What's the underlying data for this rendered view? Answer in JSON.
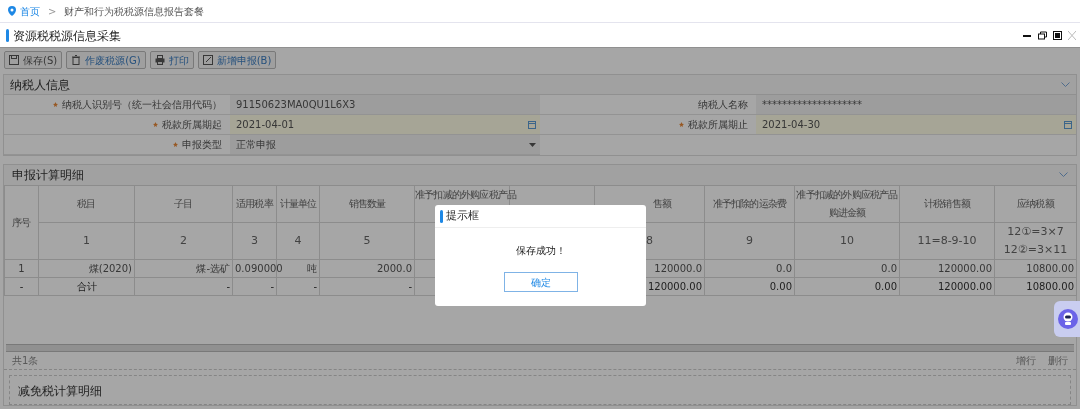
{
  "breadcrumb": {
    "home": "首页",
    "separator": ">",
    "current": "财产和行为税税源信息报告套餐"
  },
  "window": {
    "title": "资源税税源信息采集"
  },
  "toolbar": [
    {
      "label": "保存(S)",
      "kind": "save"
    },
    {
      "label": "作废税源(G)",
      "kind": "delete"
    },
    {
      "label": "打印",
      "kind": "print"
    },
    {
      "label": "新增申报(B)",
      "kind": "edit"
    }
  ],
  "taxpayer": {
    "title": "纳税人信息",
    "fields": [
      {
        "label": "纳税人识别号（统一社会信用代码）",
        "value": "91150623MA0QU1L6X3",
        "required": true,
        "kind": "text"
      },
      {
        "label": "纳税人名称",
        "value": "********************",
        "required": false,
        "kind": "text"
      },
      {
        "label": "税款所属期起",
        "value": "2021-04-01",
        "required": true,
        "kind": "date"
      },
      {
        "label": "税款所属期止",
        "value": "2021-04-30",
        "required": true,
        "kind": "date"
      },
      {
        "label": "申报类型",
        "value": "正常申报",
        "required": true,
        "kind": "select"
      }
    ]
  },
  "detail": {
    "title": "申报计算明细",
    "columns": [
      {
        "header": [
          "序号"
        ]
      },
      {
        "header": [
          "税目"
        ],
        "index": [
          "1"
        ]
      },
      {
        "header": [
          "子目"
        ],
        "index": [
          "2"
        ]
      },
      {
        "header": [
          "适用税率"
        ],
        "index": [
          "3"
        ]
      },
      {
        "header": [
          "计量单位"
        ],
        "index": [
          "4"
        ]
      },
      {
        "header": [
          "销售数量"
        ],
        "index": [
          "5"
        ]
      },
      {
        "header": [
          "准予扣减的外购应税产品"
        ]
      },
      {},
      {
        "header": [
          "售额"
        ],
        "index": [
          "8"
        ]
      },
      {
        "header": [
          "准予扣除的运杂费"
        ],
        "index": [
          "9"
        ]
      },
      {
        "header": [
          "准予扣减的外购应税产品",
          "购进金额"
        ],
        "index": [
          "10"
        ]
      },
      {
        "header": [
          "计税销售额"
        ],
        "index": [
          "11=8-9-10"
        ]
      },
      {
        "header": [
          "应纳税额"
        ],
        "index": [
          "12①=3×7",
          "12②=3×11"
        ]
      }
    ],
    "rows": [
      {
        "kind": "data",
        "cells": [
          "1",
          "煤(2020)",
          "煤-选矿",
          "0.090000",
          "吨",
          "2000.0",
          null,
          null,
          "120000.0",
          "0.0",
          "0.0",
          "120000.00",
          "10800.00"
        ]
      },
      {
        "kind": "total",
        "cells": [
          "-",
          "合计",
          "-",
          "-",
          "-",
          "-",
          null,
          null,
          "120000.00",
          "0.00",
          "0.00",
          "120000.00",
          "10800.00"
        ]
      }
    ],
    "count": "共1条",
    "actions": [
      "增行",
      "删行"
    ]
  },
  "relief": {
    "title": "减免税计算明细"
  },
  "dialog": {
    "title": "提示框",
    "message": "保存成功！",
    "button": "确定"
  }
}
